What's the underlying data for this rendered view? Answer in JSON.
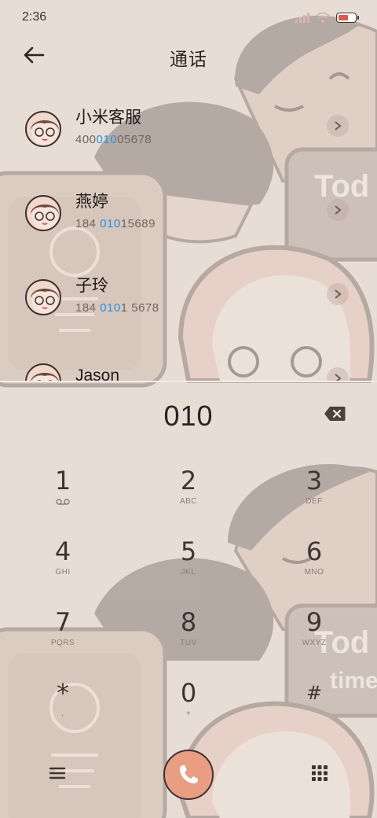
{
  "status_bar": {
    "time": "2:36",
    "icons": [
      "signal-icon",
      "wifi-icon",
      "battery-icon"
    ]
  },
  "header": {
    "title": "通话",
    "back_icon": "back-arrow-icon"
  },
  "contacts": [
    {
      "name": "小米客服",
      "number_pre": "400",
      "number_hl": "010",
      "number_post": "05678"
    },
    {
      "name": "燕婷",
      "number_pre": "184 ",
      "number_hl": "010",
      "number_post": "15689"
    },
    {
      "name": "子玲",
      "number_pre": "184 ",
      "number_hl": "010",
      "number_post": "1 5678"
    },
    {
      "name": "Jason",
      "number_pre": "",
      "number_hl": "",
      "number_post": ""
    }
  ],
  "dialer": {
    "input": "010",
    "keys": [
      {
        "digit": "1",
        "letters": ""
      },
      {
        "digit": "2",
        "letters": "ABC"
      },
      {
        "digit": "3",
        "letters": "DEF"
      },
      {
        "digit": "4",
        "letters": "GHI"
      },
      {
        "digit": "5",
        "letters": "JKL"
      },
      {
        "digit": "6",
        "letters": "MNO"
      },
      {
        "digit": "7",
        "letters": "PQRS"
      },
      {
        "digit": "8",
        "letters": "TUV"
      },
      {
        "digit": "9",
        "letters": "WXYZ"
      },
      {
        "digit": "*",
        "letters": ","
      },
      {
        "digit": "0",
        "letters": "+"
      },
      {
        "digit": "#",
        "letters": ""
      }
    ]
  },
  "background_text": {
    "line1": "Tod",
    "line2": "time"
  },
  "colors": {
    "background": "#e8ddd5",
    "highlight": "#2a8fe0",
    "call_button": "#e99d82"
  }
}
